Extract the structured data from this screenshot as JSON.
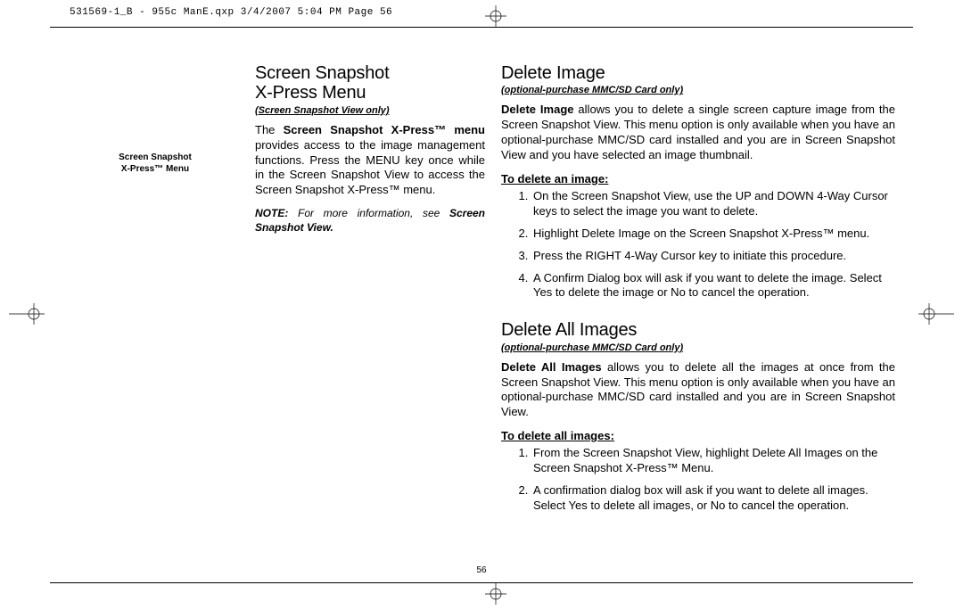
{
  "header": "531569-1_B - 955c ManE.qxp  3/4/2007  5:04 PM  Page 56",
  "caption": {
    "line1": "Screen Snapshot",
    "line2": "X-Press™ Menu"
  },
  "mid": {
    "title1": "Screen Snapshot",
    "title2": "X-Press  Menu",
    "subtitle": "(Screen Snapshot View only)",
    "para_lead": "Screen Snapshot X-Press™ menu",
    "para_before": "The ",
    "para_after": " provides access to the image management functions. Press the MENU key once while in the Screen Snapshot View to access the Screen Snapshot X-Press™ menu.",
    "note_lead": "NOTE:",
    "note_text": " For more information, see ",
    "note_ref": "Screen Snapshot View."
  },
  "right": {
    "s1": {
      "title": "Delete Image",
      "subtitle": "(optional-purchase MMC/SD Card only)",
      "para_lead": "Delete Image",
      "para_after": " allows you to delete a single screen capture image from the Screen Snapshot View. This menu option is only available when you have an optional-purchase MMC/SD card installed and you are in Screen Snapshot View and you have selected an image thumbnail.",
      "howto": "To delete an image:",
      "steps": [
        "On the Screen Snapshot View, use the UP and DOWN 4-Way Cursor keys to select the image you want to delete.",
        "Highlight Delete Image on the Screen Snapshot X-Press™ menu.",
        "Press the RIGHT 4-Way Cursor key to initiate this procedure.",
        "A Confirm Dialog box will ask if you want to delete the image. Select Yes to delete the image or No to cancel the operation."
      ]
    },
    "s2": {
      "title": "Delete All Images",
      "subtitle": "(optional-purchase MMC/SD Card only)",
      "para_lead": "Delete All Images",
      "para_after": " allows you to delete all the images at once from the Screen Snapshot View. This menu option is only available when you have an optional-purchase MMC/SD card installed and you are in Screen Snapshot View.",
      "howto": "To delete all images:",
      "steps": [
        "From the Screen Snapshot View, highlight Delete All Images on the Screen Snapshot X-Press™ Menu.",
        "A confirmation dialog box will ask if you want to delete all images. Select Yes to delete all images, or No to cancel the operation."
      ]
    }
  },
  "pagenum": "56"
}
